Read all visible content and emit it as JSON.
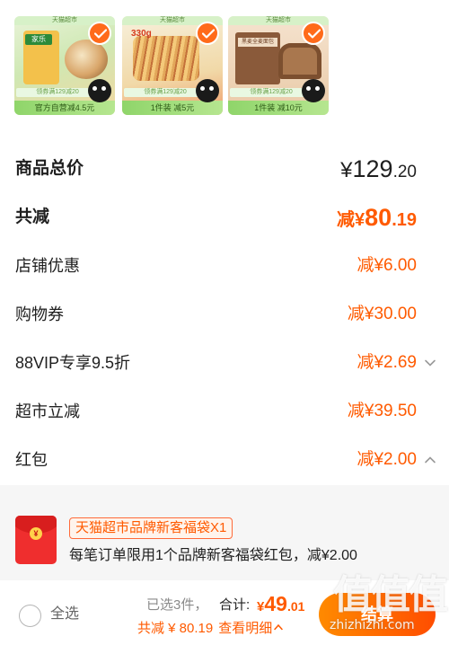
{
  "products": [
    {
      "banner": "天猫超市",
      "promo": "领券满129减20",
      "discount": "官方自营减4.5元",
      "brand": "家乐"
    },
    {
      "banner": "天猫超市",
      "promo": "领券满129减20",
      "discount": "1件装 减5元",
      "badge": "330g"
    },
    {
      "banner": "天猫超市",
      "promo": "领券满129减20",
      "discount": "1件装 减10元",
      "box_text": "黑麦全麦面包"
    }
  ],
  "summary": {
    "total": {
      "label": "商品总价",
      "symbol": "¥",
      "int": "129",
      "dec": ".20"
    },
    "saved": {
      "label": "共减",
      "prefix": "减¥",
      "int": "80",
      "dec": ".19"
    },
    "rows": [
      {
        "label": "店铺优惠",
        "value": "减¥6.00"
      },
      {
        "label": "购物券",
        "value": "减¥30.00"
      },
      {
        "label": "88VIP专享9.5折",
        "value": "减¥2.69",
        "chevron": "down"
      },
      {
        "label": "超市立减",
        "value": "减¥39.50"
      },
      {
        "label": "红包",
        "value": "减¥2.00",
        "chevron": "up"
      }
    ]
  },
  "red_packet": {
    "tag": "天猫超市品牌新客福袋X1",
    "description": "每笔订单限用1个品牌新客福袋红包，减¥2.00",
    "coin": "¥"
  },
  "bottom_bar": {
    "select_all": "全选",
    "selected_count": "已选3件，",
    "sum_label": "合计:",
    "sum_symbol": "¥",
    "sum_int": "49",
    "sum_dec": ".01",
    "saved_text": "共减 ¥ 80.19",
    "detail_link": "查看明细",
    "checkout_label": "结算"
  },
  "watermark": {
    "glyphs": "值值值",
    "site": "zhizhizhi.com"
  },
  "colors": {
    "accent": "#ff5a00",
    "checkout_start": "#ff8a00",
    "checkout_end": "#ff4d00",
    "packet_red": "#ef2e2e"
  }
}
